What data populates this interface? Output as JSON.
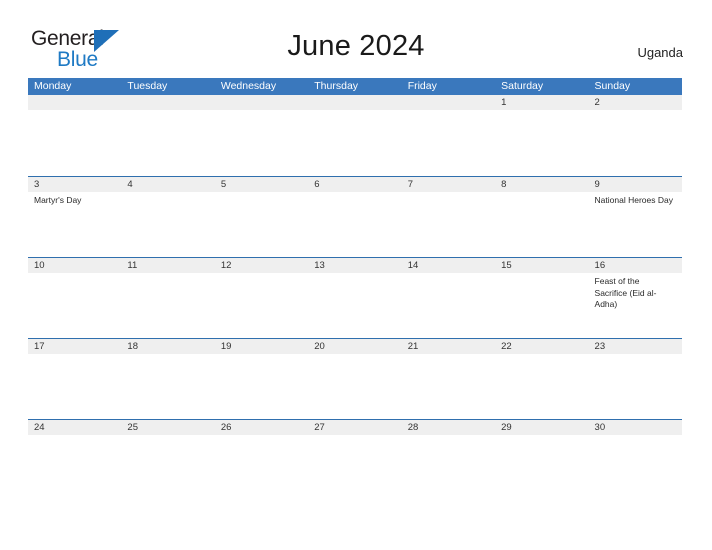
{
  "brand": {
    "name_part1": "General",
    "name_part2": "Blue",
    "flag_icon": "blue-triangle-flag",
    "accent_color": "#1f7ac4"
  },
  "header": {
    "title": "June 2024",
    "country": "Uganda",
    "header_bg_color": "#3a78bd",
    "date_band_color": "#efefef",
    "week_divider_color": "#2f6fae"
  },
  "weekdays": [
    "Monday",
    "Tuesday",
    "Wednesday",
    "Thursday",
    "Friday",
    "Saturday",
    "Sunday"
  ],
  "weeks": [
    {
      "days": [
        {
          "date": "",
          "event": ""
        },
        {
          "date": "",
          "event": ""
        },
        {
          "date": "",
          "event": ""
        },
        {
          "date": "",
          "event": ""
        },
        {
          "date": "",
          "event": ""
        },
        {
          "date": "1",
          "event": ""
        },
        {
          "date": "2",
          "event": ""
        }
      ]
    },
    {
      "days": [
        {
          "date": "3",
          "event": "Martyr's Day"
        },
        {
          "date": "4",
          "event": ""
        },
        {
          "date": "5",
          "event": ""
        },
        {
          "date": "6",
          "event": ""
        },
        {
          "date": "7",
          "event": ""
        },
        {
          "date": "8",
          "event": ""
        },
        {
          "date": "9",
          "event": "National Heroes Day"
        }
      ]
    },
    {
      "days": [
        {
          "date": "10",
          "event": ""
        },
        {
          "date": "11",
          "event": ""
        },
        {
          "date": "12",
          "event": ""
        },
        {
          "date": "13",
          "event": ""
        },
        {
          "date": "14",
          "event": ""
        },
        {
          "date": "15",
          "event": ""
        },
        {
          "date": "16",
          "event": "Feast of the Sacrifice (Eid al-Adha)"
        }
      ]
    },
    {
      "days": [
        {
          "date": "17",
          "event": ""
        },
        {
          "date": "18",
          "event": ""
        },
        {
          "date": "19",
          "event": ""
        },
        {
          "date": "20",
          "event": ""
        },
        {
          "date": "21",
          "event": ""
        },
        {
          "date": "22",
          "event": ""
        },
        {
          "date": "23",
          "event": ""
        }
      ]
    },
    {
      "days": [
        {
          "date": "24",
          "event": ""
        },
        {
          "date": "25",
          "event": ""
        },
        {
          "date": "26",
          "event": ""
        },
        {
          "date": "27",
          "event": ""
        },
        {
          "date": "28",
          "event": ""
        },
        {
          "date": "29",
          "event": ""
        },
        {
          "date": "30",
          "event": ""
        }
      ]
    }
  ]
}
